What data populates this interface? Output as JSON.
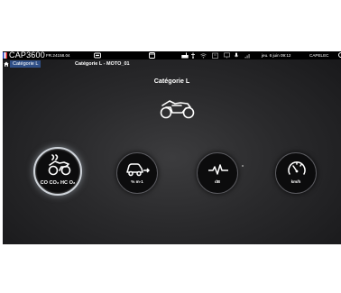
{
  "statusbar": {
    "brand": "CAP3600",
    "serial": "FR.24158.04",
    "date": "jeu. 6 juin 09:12",
    "vendor": "CAPELEC",
    "icons": [
      "flag-icon",
      "printer-icon",
      "window-icon",
      "keyboard-icon",
      "usb-icon",
      "wifi-icon",
      "gas-analyzer-icon",
      "display-icon",
      "microphone-icon",
      "signal-icon",
      "power-icon"
    ]
  },
  "nav": {
    "home_icon": "home-icon",
    "breadcrumb": "Catégorie L",
    "subtitle": "Catégorie L - MOTO_01"
  },
  "main": {
    "title": "Catégorie L",
    "category_icon": "motorcycle-icon",
    "buttons": [
      {
        "label": "CO CO₂ HC O₂",
        "icon": "motorcycle-exhaust-icon",
        "selected": true
      },
      {
        "label": "% m-1",
        "icon": "car-smoke-icon",
        "selected": false
      },
      {
        "label": "dB",
        "icon": "sound-wave-icon",
        "selected": false
      },
      {
        "label": "km/h",
        "icon": "speedometer-icon",
        "selected": false
      }
    ]
  },
  "colors": {
    "breadcrumb_bg": "#2f4f86",
    "screen_bg": "#2a2a2c",
    "button_bg": "#0c0c0d",
    "selected_ring": "#cfd4da"
  }
}
